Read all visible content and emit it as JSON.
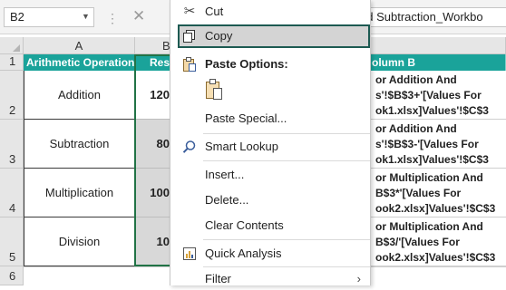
{
  "formula_bar": {
    "name_box": "B2",
    "formula_text": "nd Subtraction_Workbo"
  },
  "columns": [
    "A",
    "B"
  ],
  "rows": [
    "1",
    "2",
    "3",
    "4",
    "5",
    "6"
  ],
  "table": {
    "header_a": "Arithmetic Operation",
    "header_b": "Res",
    "header_c": "olumn B",
    "rows": [
      {
        "operation": "Addition",
        "result": "120",
        "formula": [
          "or Addition And",
          "s'!$B$3+'[Values For",
          "ok1.xlsx]Values'!$C$3"
        ]
      },
      {
        "operation": "Subtraction",
        "result": "80",
        "formula": [
          "or Addition And",
          "s'!$B$3-'[Values For",
          "ok1.xlsx]Values'!$C$3"
        ]
      },
      {
        "operation": "Multiplication",
        "result": "100",
        "formula": [
          "or Multiplication And",
          "B$3*'[Values For",
          "ook2.xlsx]Values'!$C$3"
        ]
      },
      {
        "operation": "Division",
        "result": "10",
        "formula": [
          "or Multiplication And",
          "B$3/'[Values For",
          "ook2.xlsx]Values'!$C$3"
        ]
      }
    ]
  },
  "context_menu": {
    "cut": "Cut",
    "copy": "Copy",
    "paste_options": "Paste Options:",
    "paste_special": "Paste Special...",
    "smart_lookup": "Smart Lookup",
    "insert": "Insert...",
    "delete": "Delete...",
    "clear_contents": "Clear Contents",
    "quick_analysis": "Quick Analysis",
    "filter": "Filter"
  },
  "colors": {
    "header_fill": "#1aa39a",
    "selected_fill": "#d8d8d8",
    "menu_highlight_border": "#1d5a52"
  }
}
